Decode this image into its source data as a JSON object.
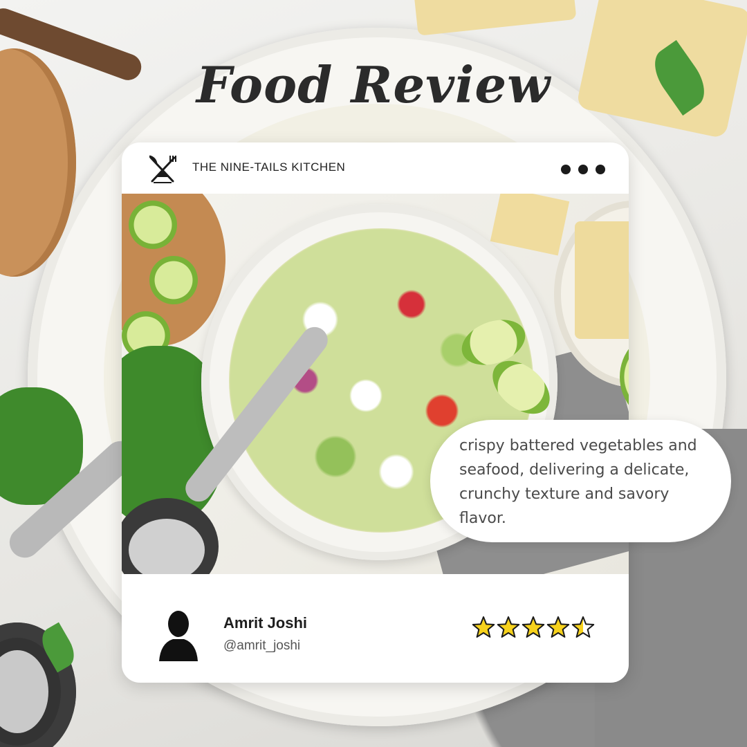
{
  "title": "Food Review",
  "brand": {
    "name": "THE NINE-TAILS KITCHEN",
    "logo_icon": "crossed-fork-knife-icon"
  },
  "more_icon": "more-dots-icon",
  "photo": {
    "subject": "ceviche-bowl-photo"
  },
  "review": {
    "text": "crispy battered vegetables and seafood, delivering a delicate, crunchy texture and savory flavor."
  },
  "reviewer": {
    "name": "Amrit Joshi",
    "handle": "@amrit_joshi",
    "avatar_icon": "user-silhouette-icon"
  },
  "rating": {
    "value": 4.5,
    "max": 5,
    "star_color": "#f7d21c",
    "star_outline_color": "#1a1a1a"
  },
  "colors": {
    "card_background": "#ffffff",
    "title_color": "#2b2b2b",
    "text_color": "#4a4a4a"
  }
}
